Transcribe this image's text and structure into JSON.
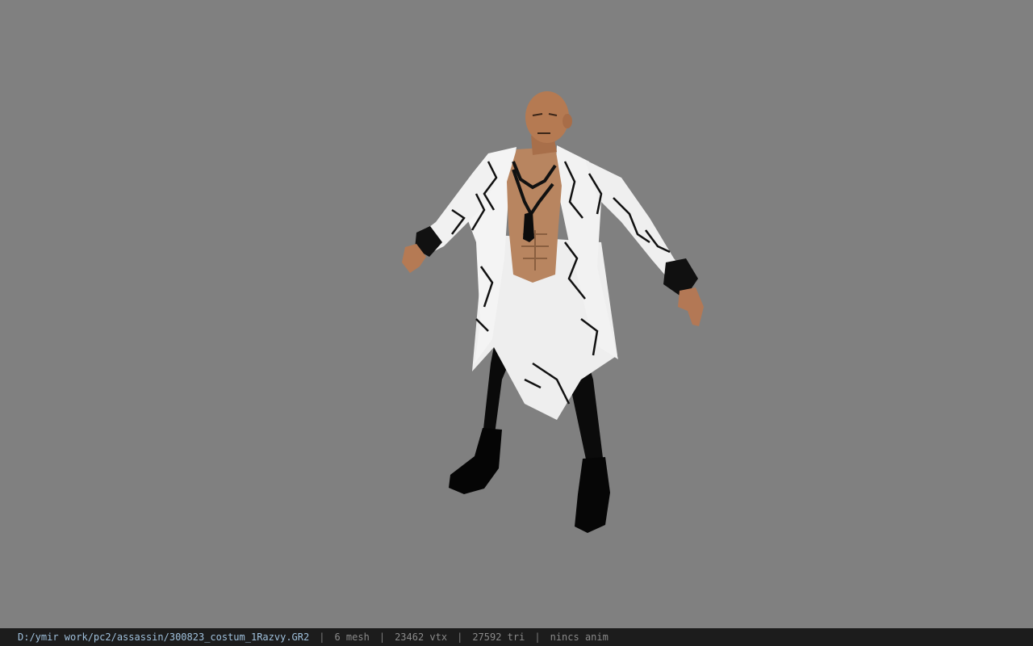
{
  "viewer": {
    "background_color": "#808080",
    "model_subject": "character-costume-model"
  },
  "statusbar": {
    "file_path": "D:/ymir work/pc2/assassin/300823_costum_1Razvy.GR2",
    "separator": "|",
    "mesh_count": "6 mesh",
    "vertex_count": "23462 vtx",
    "triangle_count": "27592 tri",
    "anim_status": "nincs anim"
  },
  "colors": {
    "statusbar_bg": "#1c1c1c",
    "path_text": "#9fc0dc",
    "info_text": "#8a8a8a"
  }
}
